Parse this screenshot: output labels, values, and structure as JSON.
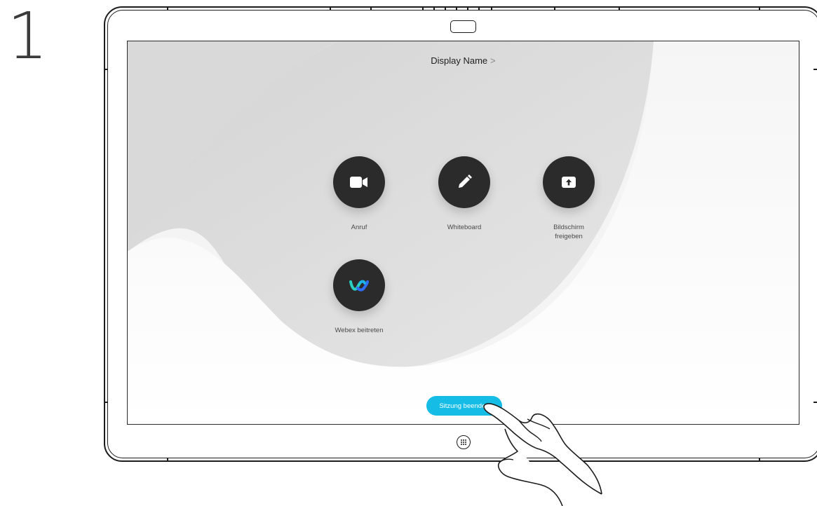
{
  "step": {
    "number": "1"
  },
  "screen": {
    "display_name": "Display Name",
    "chevron": ">",
    "tiles": [
      {
        "label": "Anruf",
        "icon": "video-camera-icon"
      },
      {
        "label": "Whiteboard",
        "icon": "pencil-icon"
      },
      {
        "label": "Bildschirm freigeben",
        "icon": "share-screen-icon"
      },
      {
        "label": "Webex beitreten",
        "icon": "webex-logo-icon"
      }
    ],
    "end_session_label": "Sitzung beenden"
  },
  "colors": {
    "tile_background": "#2b2b2b",
    "accent": "#14bce6",
    "screen_gray": "#d8d8d8"
  }
}
